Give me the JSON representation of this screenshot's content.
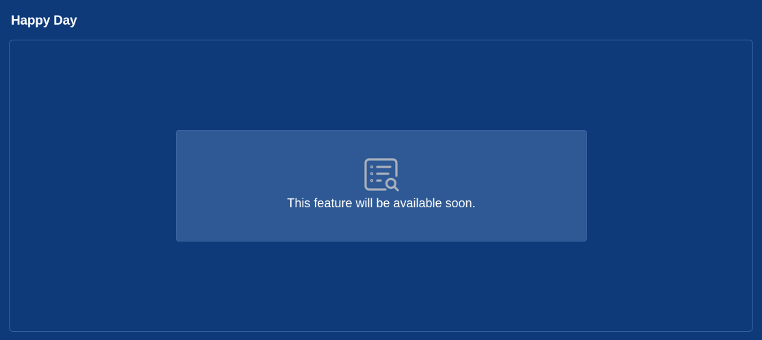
{
  "header": {
    "title": "Happy Day"
  },
  "main": {
    "notice": {
      "icon": "document-search-icon",
      "message": "This feature will be available soon."
    }
  },
  "colors": {
    "background": "#0f3a7a",
    "panel_border": "#3460a2",
    "card_background": "#2f5994",
    "icon_color": "#a8b0bd",
    "text": "#ffffff"
  }
}
